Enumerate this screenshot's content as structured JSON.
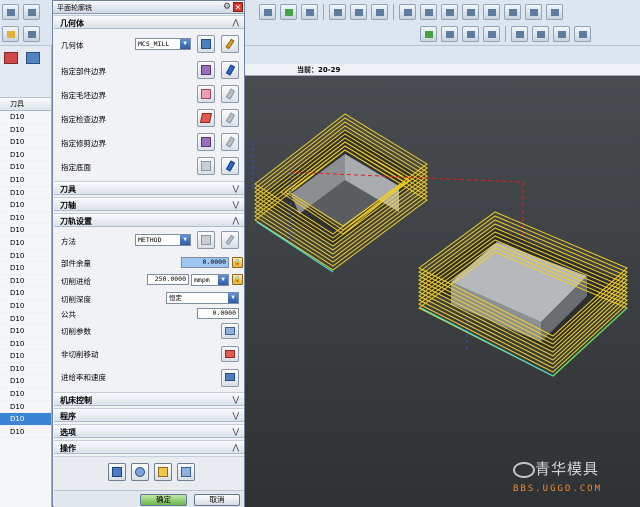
{
  "dialog": {
    "title": "平面轮廓铣",
    "sections": {
      "geometry": "几何体",
      "tool": "刀具",
      "tool_axis": "刀轴",
      "path_settings": "刀轨设置",
      "machine_control": "机床控制",
      "program": "程序",
      "options": "选项",
      "actions": "操作"
    },
    "geometry": {
      "geometry_label": "几何体",
      "geometry_value": "MCS_MILL",
      "part_boundary": "指定部件边界",
      "blank_boundary": "指定毛坯边界",
      "check_boundary": "指定检查边界",
      "trim_boundary": "指定修剪边界",
      "floor": "指定底面"
    },
    "path": {
      "method_label": "方法",
      "method_value": "METHOD",
      "stock_label": "部件余量",
      "stock_value": "0.0000",
      "feed_label": "切削进给",
      "feed_value": "250.0000",
      "feed_unit": "mmpm",
      "depth_label": "切削深度",
      "depth_value": "恒定",
      "common_label": "公共",
      "common_value": "0.0000",
      "cut_params": "切削参数",
      "non_cut_moves": "非切削移动",
      "feeds_speeds": "进给率和速度"
    },
    "ok": "确定",
    "cancel": "取消"
  },
  "navigator": {
    "header": "刀具",
    "tools": [
      "D10",
      "D10",
      "D10",
      "D10",
      "D10",
      "D10",
      "D10",
      "D10",
      "D10",
      "D10",
      "D10",
      "D10",
      "D10",
      "D10",
      "D10",
      "D10",
      "D10",
      "D10",
      "D10",
      "D10",
      "D10",
      "D10",
      "D10",
      "D10",
      "D10",
      "D10"
    ],
    "selected_index": 24
  },
  "viewport": {
    "current_label": "当前：",
    "current_value": "20-29"
  },
  "watermark": {
    "text": "青华模具",
    "url": "BBS.UGGO.COM"
  },
  "colors": {
    "toolpath": "#f4d020",
    "part": "#c9c9c9",
    "selection": "#3a84d6",
    "ok_button": "#6cb84b"
  }
}
